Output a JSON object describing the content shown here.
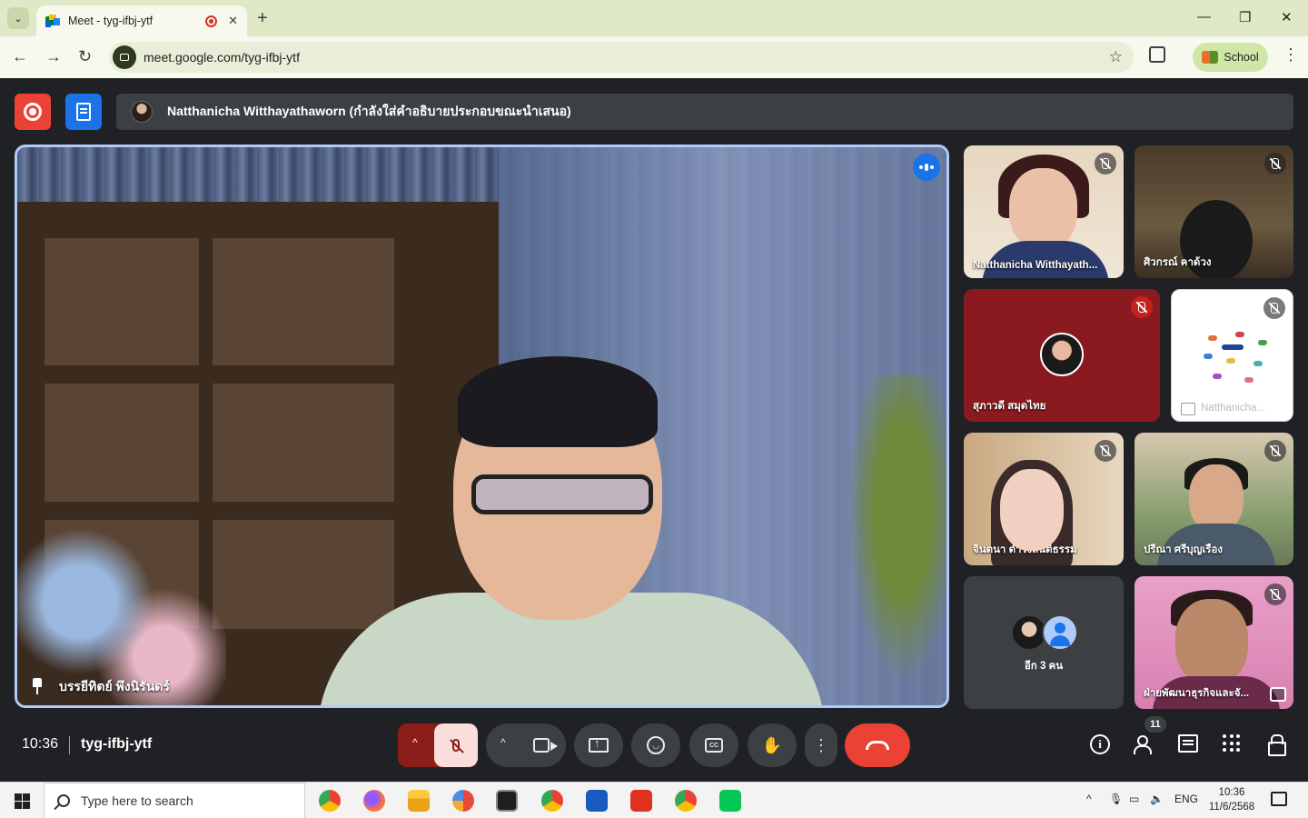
{
  "browser": {
    "tab_title": "Meet - tyg-ifbj-ytf",
    "tab_close": "✕",
    "new_tab": "+",
    "url": "meet.google.com/tyg-ifbj-ytf",
    "profile_label": "School",
    "window_controls": {
      "minimize": "—",
      "maximize": "❐",
      "close": "✕"
    }
  },
  "meet": {
    "presenter_banner": "Natthanicha Witthayathaworn (กำลังใส่คำอธิบายประกอบขณะนำเสนอ)",
    "main_speaker_name": "บรรยีทิตย์ พึงนิรันดร์",
    "participants": [
      {
        "name": "Natthanicha Witthayath...",
        "muted": true
      },
      {
        "name": "ศิวกรณ์ คาด้วง",
        "muted": true
      },
      {
        "name": "สุภาวดี สมุดไทย",
        "muted": true
      },
      {
        "name": "Natthanicha...",
        "muted": true,
        "is_presentation": true
      },
      {
        "name": "จินตนา ดำรงสันติธรรม",
        "muted": true
      },
      {
        "name": "ปรีณา ศรีบุญเรือง",
        "muted": true
      },
      {
        "name": "อีก 3 คน",
        "is_overflow": true
      },
      {
        "name": "ฝ่ายพัฒนาธุรกิจและจั...",
        "muted": true
      }
    ],
    "time": "10:36",
    "meeting_code": "tyg-ifbj-ytf",
    "participant_count": "11",
    "icons": {
      "record": "record-icon",
      "notes": "notes-icon",
      "mic": "mic-off-icon",
      "camera": "camera-icon",
      "present": "present-screen-icon",
      "emoji": "emoji-icon",
      "captions": "captions-icon",
      "hand": "raise-hand-icon",
      "more": "more-vert-icon",
      "end": "end-call-icon",
      "info": "info-icon",
      "people": "people-icon",
      "chat": "chat-icon",
      "activities": "apps-icon",
      "host_controls": "lock-person-icon"
    },
    "colors": {
      "record_red": "#ea4335",
      "notes_blue": "#1a73e8",
      "mic_off_bg": "#8c1d18",
      "end_call": "#ea4335",
      "active_border": "#aecbfa"
    },
    "captions_glyph": "CC",
    "hand_glyph": "✋",
    "more_glyph": "⋮",
    "emoji_glyph": "◡",
    "caret": "^",
    "info_glyph": "i"
  },
  "taskbar": {
    "search_placeholder": "Type here to search",
    "time": "10:36",
    "date": "11/6/2568",
    "language": "ENG",
    "tray_caret": "^"
  }
}
